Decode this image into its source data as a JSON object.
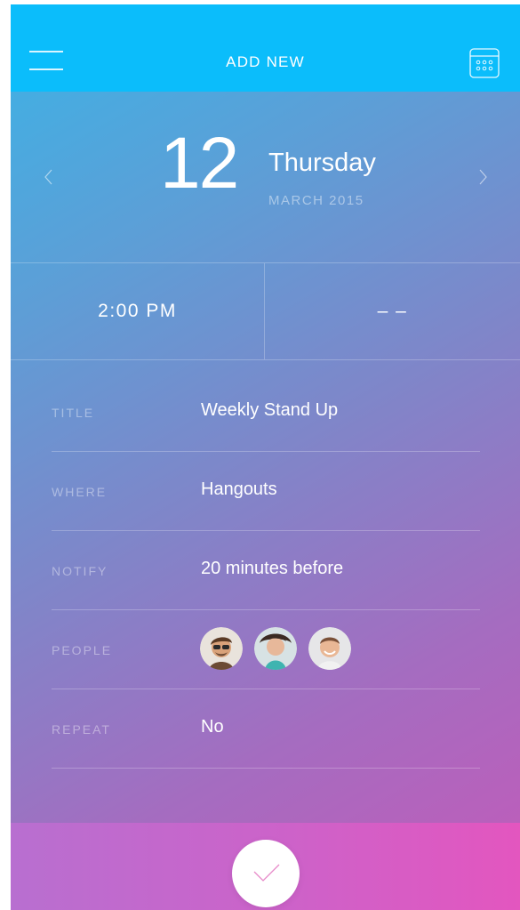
{
  "header": {
    "title": "ADD NEW",
    "menu_icon": "hamburger-menu-icon",
    "calendar_icon": "calendar-icon",
    "color": "#0bbdfb"
  },
  "date": {
    "day": "12",
    "weekday": "Thursday",
    "month_year": "MARCH 2015",
    "prev_icon": "chevron-left-icon",
    "next_icon": "chevron-right-icon"
  },
  "time": {
    "start": "2:00 PM",
    "end": "– –"
  },
  "fields": {
    "title": {
      "label": "TITLE",
      "value": "Weekly Stand Up"
    },
    "where": {
      "label": "WHERE",
      "value": "Hangouts"
    },
    "notify": {
      "label": "NOTIFY",
      "value": "20 minutes before"
    },
    "people": {
      "label": "PEOPLE",
      "count": 3
    },
    "repeat": {
      "label": "REPEAT",
      "value": "No"
    }
  },
  "footer": {
    "confirm_icon": "checkmark-icon",
    "accent": "#e356bf"
  }
}
